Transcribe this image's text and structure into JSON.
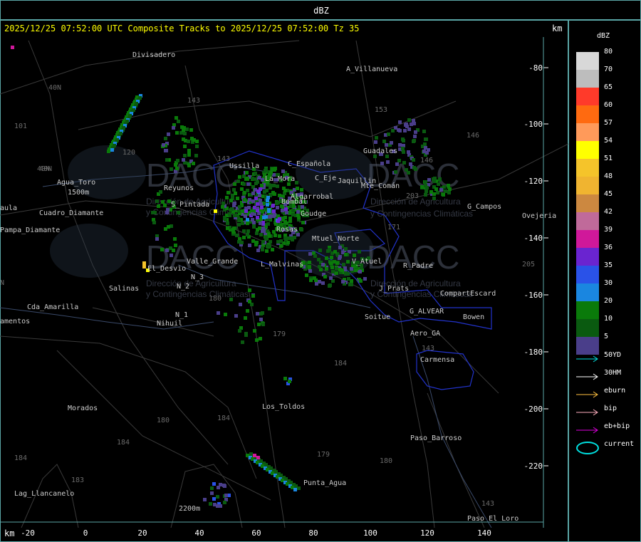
{
  "window": {
    "title": "dBZ"
  },
  "header": {
    "line": "2025/12/25 07:52:00 UTC Composite Tracks to 2025/12/25 07:52:00 Tz 35",
    "unit_top": "km",
    "unit_bottom": "km"
  },
  "axes": {
    "y_ticks": [
      "-80",
      "-100",
      "-120",
      "-140",
      "-160",
      "-180",
      "-200",
      "-220"
    ],
    "x_ticks": [
      "-20",
      "0",
      "20",
      "40",
      "60",
      "80",
      "100",
      "120",
      "140"
    ]
  },
  "legend": {
    "title": "dBZ",
    "levels": [
      {
        "label": "80",
        "color": "#d8d8d8"
      },
      {
        "label": "70",
        "color": "#bdbdbd"
      },
      {
        "label": "65",
        "color": "#ff3a2a"
      },
      {
        "label": "60",
        "color": "#ff6a10"
      },
      {
        "label": "57",
        "color": "#ff9a5a"
      },
      {
        "label": "54",
        "color": "#ffff00"
      },
      {
        "label": "51",
        "color": "#f5c42a"
      },
      {
        "label": "48",
        "color": "#f0b430"
      },
      {
        "label": "45",
        "color": "#cc8840"
      },
      {
        "label": "42",
        "color": "#c06a9a"
      },
      {
        "label": "39",
        "color": "#d0189a"
      },
      {
        "label": "36",
        "color": "#6a24d0"
      },
      {
        "label": "35",
        "color": "#2a52e8"
      },
      {
        "label": "30",
        "color": "#1a86e0"
      },
      {
        "label": "20",
        "color": "#0a7a0a"
      },
      {
        "label": "10",
        "color": "#0a5a10"
      },
      {
        "label": "5",
        "color": "#4a3e8a"
      }
    ],
    "tracks": [
      {
        "label": "50YD",
        "color": "#00e0e0"
      },
      {
        "label": "30HM",
        "color": "#ffffff"
      },
      {
        "label": "eburn",
        "color": "#ffc040"
      },
      {
        "label": "bip",
        "color": "#ffb0c0"
      },
      {
        "label": "eb+bip",
        "color": "#e000e0"
      },
      {
        "label": "current",
        "color": "#00e0e0"
      }
    ]
  },
  "map": {
    "places": [
      {
        "name": "Divisadero",
        "color": "#cccccc"
      },
      {
        "name": "A_Villanueva",
        "color": "#cccccc"
      },
      {
        "name": "Guadales",
        "color": "#cccccc"
      },
      {
        "name": "Ussilla",
        "color": "#cccccc"
      },
      {
        "name": "C_Española",
        "color": "#cccccc"
      },
      {
        "name": "La_Mora",
        "color": "#cccccc"
      },
      {
        "name": "C_Eje",
        "color": "#cccccc"
      },
      {
        "name": "Jaquillin",
        "color": "#cccccc"
      },
      {
        "name": "Mte_Comán",
        "color": "#cccccc"
      },
      {
        "name": "Agua_Toro",
        "color": "#cccccc"
      },
      {
        "name": "1500m",
        "color": "#cccccc"
      },
      {
        "name": "Reyunos",
        "color": "#cccccc"
      },
      {
        "name": "S_Pintada",
        "color": "#cccccc"
      },
      {
        "name": "Algarrobal",
        "color": "#cccccc"
      },
      {
        "name": "Bombal",
        "color": "#cccccc"
      },
      {
        "name": "Goudge",
        "color": "#cccccc"
      },
      {
        "name": "G_Campos",
        "color": "#cccccc"
      },
      {
        "name": "Ovejeria",
        "color": "#cccccc"
      },
      {
        "name": "aula",
        "color": "#cccccc"
      },
      {
        "name": "Pampa_Diamante",
        "color": "#cccccc"
      },
      {
        "name": "Cuadro_Diamante",
        "color": "#cccccc"
      },
      {
        "name": "Rosas",
        "color": "#cccccc"
      },
      {
        "name": "Mtuel_Norte",
        "color": "#cccccc"
      },
      {
        "name": "Valle_Grande",
        "color": "#cccccc"
      },
      {
        "name": "El_Desvio",
        "color": "#cccccc"
      },
      {
        "name": "L_Malvinas",
        "color": "#cccccc"
      },
      {
        "name": "V_Atuel",
        "color": "#cccccc"
      },
      {
        "name": "R_Padre",
        "color": "#cccccc"
      },
      {
        "name": "Salinas",
        "color": "#cccccc"
      },
      {
        "name": "N_2",
        "color": "#cccccc"
      },
      {
        "name": "N_3",
        "color": "#cccccc"
      },
      {
        "name": "N_1",
        "color": "#cccccc"
      },
      {
        "name": "Nihuil",
        "color": "#cccccc"
      },
      {
        "name": "J_Prats",
        "color": "#cccccc"
      },
      {
        "name": "CompartEscard",
        "color": "#cccccc"
      },
      {
        "name": "Cda_Amarilla",
        "color": "#cccccc"
      },
      {
        "name": "amentos",
        "color": "#cccccc"
      },
      {
        "name": "Soitue",
        "color": "#cccccc"
      },
      {
        "name": "G_ALVEAR",
        "color": "#cccccc"
      },
      {
        "name": "Bowen",
        "color": "#cccccc"
      },
      {
        "name": "Aero_GA",
        "color": "#cccccc"
      },
      {
        "name": "Carmensa",
        "color": "#cccccc"
      },
      {
        "name": "Morados",
        "color": "#cccccc"
      },
      {
        "name": "Los_Toldos",
        "color": "#cccccc"
      },
      {
        "name": "Paso_Barroso",
        "color": "#cccccc"
      },
      {
        "name": "Punta_Agua",
        "color": "#cccccc"
      },
      {
        "name": "Lag_Llancanelo",
        "color": "#cccccc"
      },
      {
        "name": "2200m",
        "color": "#cccccc"
      },
      {
        "name": "Paso_El_Loro",
        "color": "#cccccc"
      }
    ],
    "route_numbers": [
      "101",
      "40N",
      "40N",
      "143",
      "143",
      "153",
      "146",
      "146",
      "203",
      "171",
      "184",
      "205",
      "180",
      "179",
      "184",
      "180",
      "179",
      "180",
      "184",
      "183",
      "184",
      "143",
      "143",
      "120",
      "40N",
      "N"
    ],
    "watermark": {
      "brand": "DACC",
      "line1": "Dirección de Agricultura",
      "line2": "y Contingencias Climáticas"
    }
  }
}
